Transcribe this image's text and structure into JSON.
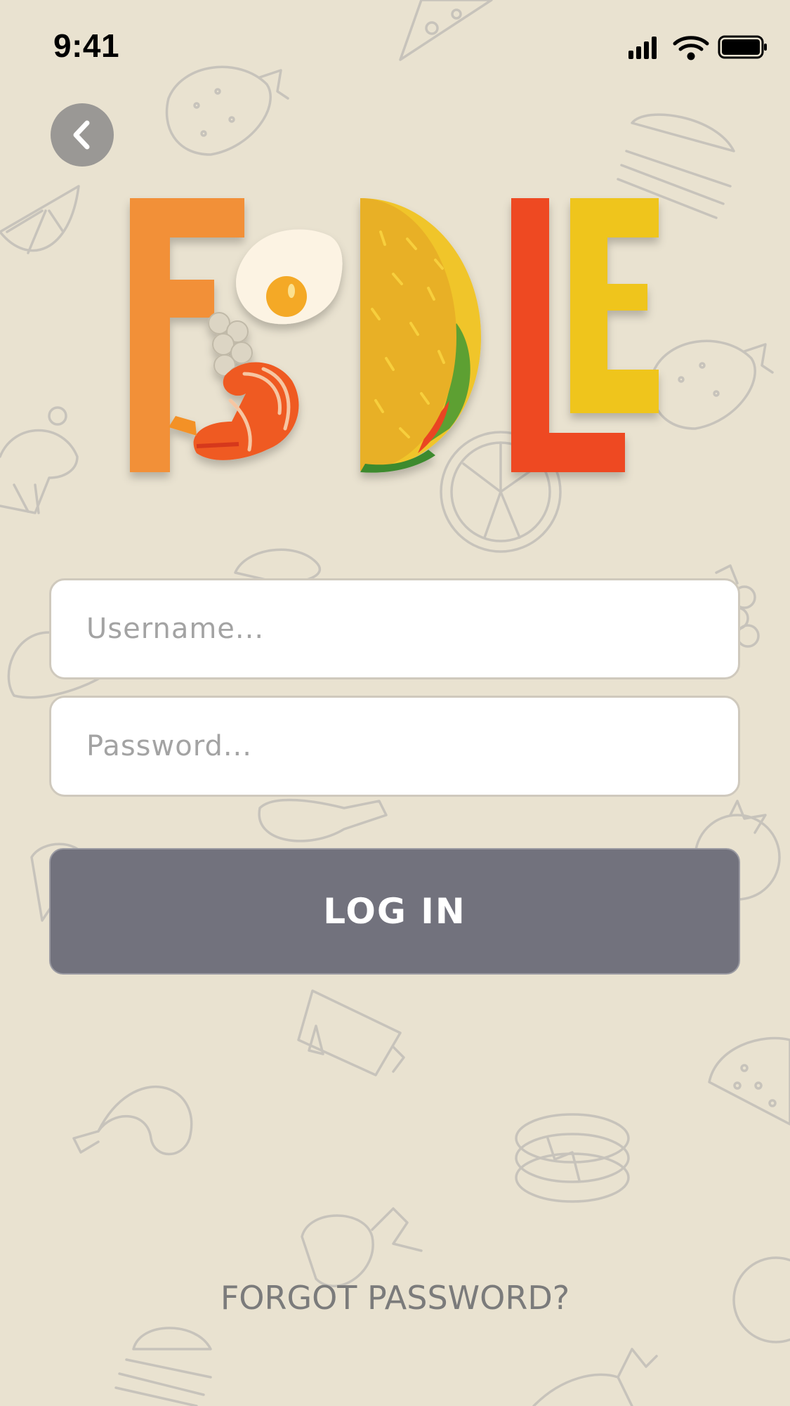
{
  "status_bar": {
    "time": "9:41",
    "icons": [
      "cellular-signal-icon",
      "wifi-icon",
      "battery-icon"
    ]
  },
  "nav": {
    "back_icon": "chevron-left-icon"
  },
  "logo": {
    "wordmark": "FOODLE",
    "letters": [
      {
        "char": "F",
        "color": "#f29038"
      },
      {
        "char": "O",
        "depicts": "fried-egg-and-shrimp-icon"
      },
      {
        "char": "D",
        "depicts": "taco-icon",
        "color": "#e8b025"
      },
      {
        "char": "L",
        "color": "#ee4a24"
      },
      {
        "char": "E",
        "color": "#efc51d"
      }
    ]
  },
  "form": {
    "username": {
      "value": "",
      "placeholder": "Username..."
    },
    "password": {
      "value": "",
      "placeholder": "Password..."
    },
    "login_label": "LOG IN"
  },
  "forgot_password_label": "FORGOT PASSWORD?",
  "colors": {
    "background": "#e9e2d0",
    "doodle_stroke": "#c7c3bb",
    "button": "#72727d",
    "back_button": "#9a9895",
    "link_text": "#7b7b7b"
  },
  "background_doodles": [
    "pizza-slice-icon",
    "strawberry-icon",
    "burger-icon",
    "lemon-slice-icon",
    "cupcake-icon",
    "fried-egg-icon",
    "grapes-icon",
    "steak-icon",
    "chicken-leg-icon",
    "tomato-icon",
    "pancakes-icon",
    "mug-icon",
    "shrimp-icon",
    "taco-icon",
    "radish-icon",
    "carrot-icon",
    "apple-icon"
  ]
}
